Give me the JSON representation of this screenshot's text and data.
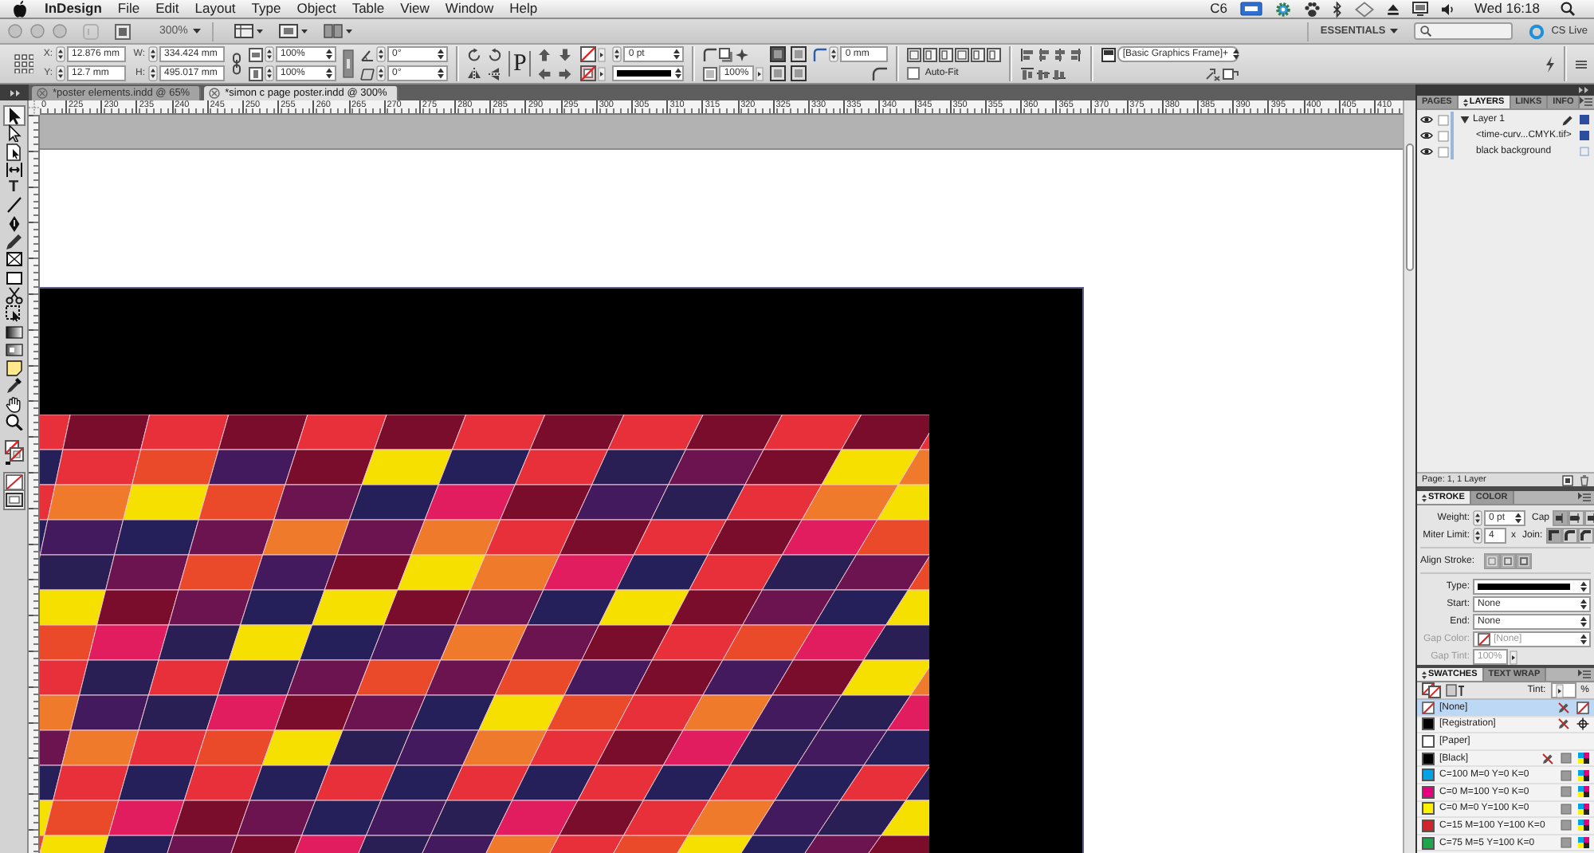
{
  "menu_bar": {
    "app_name": "InDesign",
    "menus": [
      "File",
      "Edit",
      "Layout",
      "Type",
      "Object",
      "Table",
      "View",
      "Window",
      "Help"
    ],
    "status_item": "C6",
    "clock": "Wed 16:18"
  },
  "app_bar": {
    "zoom": "300%",
    "workspace": "ESSENTIALS",
    "cs_live": "CS Live"
  },
  "control_panel": {
    "position_fields": [
      {
        "label": "X:",
        "value": "12.876 mm"
      },
      {
        "label": "Y:",
        "value": "12.7 mm"
      }
    ],
    "size_fields": [
      {
        "label": "W:",
        "value": "334.424 mm"
      },
      {
        "label": "H:",
        "value": "495.017 mm"
      }
    ],
    "scale_fields": [
      "100%",
      "100%"
    ],
    "angle_fields": [
      "0°",
      "0°"
    ],
    "flip_glyph": "P",
    "stroke_weight": "0 pt",
    "opacity": "100%",
    "corner_size": "0 mm",
    "auto_fit": {
      "label": "Auto-Fit",
      "checked": false
    },
    "object_style": "[Basic Graphics Frame]+"
  },
  "tools": [
    {
      "kind": "selection",
      "selected": true
    },
    {
      "kind": "direct-selection",
      "selected": false
    },
    {
      "kind": "page",
      "selected": false
    },
    {
      "kind": "gap",
      "selected": false
    },
    {
      "kind": "type",
      "glyph": "T",
      "selected": false
    },
    {
      "kind": "line",
      "selected": false
    },
    {
      "kind": "pen",
      "selected": false
    },
    {
      "kind": "pencil",
      "selected": false
    },
    {
      "kind": "frame",
      "selected": false
    },
    {
      "kind": "rectangle",
      "selected": false
    },
    {
      "kind": "scissors",
      "selected": false
    },
    {
      "kind": "free-transform",
      "selected": false
    },
    {
      "kind": "gradient",
      "selected": false
    },
    {
      "kind": "gradient-feather",
      "selected": false
    },
    {
      "kind": "note",
      "selected": false
    },
    {
      "kind": "eyedropper",
      "selected": false
    },
    {
      "kind": "hand",
      "selected": false
    },
    {
      "kind": "zoom",
      "selected": false
    },
    {
      "kind": "fill-stroke",
      "selected": false
    },
    {
      "kind": "apply-none",
      "selected": true
    },
    {
      "kind": "screen-mode",
      "selected": true
    }
  ],
  "document_tabs": [
    {
      "label": "*poster elements.indd @ 65%",
      "selected": false
    },
    {
      "label": "*simon c page poster.indd @ 300%",
      "selected": true
    }
  ],
  "ruler_labels": [
    "0",
    "225",
    "230",
    "235",
    "240",
    "245",
    "250",
    "255",
    "260",
    "265",
    "270",
    "275",
    "280",
    "285",
    "290",
    "295",
    "300",
    "305",
    "310",
    "315",
    "320",
    "325",
    "330",
    "335",
    "340",
    "345",
    "350",
    "355",
    "360",
    "365",
    "370",
    "375",
    "380",
    "385",
    "390",
    "395",
    "400",
    "405",
    "410"
  ],
  "layers_panel": {
    "tabs": [
      {
        "label": "PAGES",
        "selected": false
      },
      {
        "label": "LAYERS",
        "selected": true
      },
      {
        "label": "LINKS",
        "selected": false
      },
      {
        "label": "INFO",
        "selected": false
      }
    ],
    "layers": [
      {
        "name": "Layer 1",
        "visible": true,
        "expanded": true,
        "target": true,
        "selected": true,
        "children": [
          {
            "name": "<time-curv...CMYK.tif>",
            "visible": true,
            "selected": true
          },
          {
            "name": "black background",
            "visible": true,
            "selected": false
          }
        ]
      }
    ],
    "footer": "Page: 1, 1 Layer"
  },
  "stroke_panel": {
    "tabs": [
      {
        "label": "STROKE",
        "selected": true
      },
      {
        "label": "COLOR",
        "selected": false
      }
    ],
    "weight": {
      "label": "Weight:",
      "value": "0 pt"
    },
    "cap": {
      "label": "Cap",
      "options": [
        {
          "kind": "butt",
          "selected": true
        },
        {
          "kind": "round",
          "selected": false
        },
        {
          "kind": "square",
          "selected": false
        }
      ]
    },
    "miter_limit": {
      "label": "Miter Limit:",
      "value": "4",
      "unit": "x"
    },
    "join": {
      "label": "Join:",
      "options": [
        {
          "kind": "miter",
          "selected": true
        },
        {
          "kind": "round",
          "selected": false
        },
        {
          "kind": "bevel",
          "selected": false
        }
      ]
    },
    "align_stroke": {
      "label": "Align Stroke:"
    },
    "type": {
      "label": "Type:"
    },
    "start": {
      "label": "Start:",
      "value": "None"
    },
    "end": {
      "label": "End:",
      "value": "None"
    },
    "gap_color": {
      "label": "Gap Color:",
      "value": "[None]",
      "disabled": true
    },
    "gap_tint": {
      "label": "Gap Tint:",
      "value": "100%",
      "disabled": true
    }
  },
  "swatches_panel": {
    "tabs": [
      {
        "label": "SWATCHES",
        "selected": true
      },
      {
        "label": "TEXT WRAP",
        "selected": false
      }
    ],
    "tint": {
      "label": "Tint:",
      "unit": "%"
    },
    "swatches": [
      {
        "name": "[None]",
        "kind": "none",
        "selected": true,
        "editable": false
      },
      {
        "name": "[Registration]",
        "kind": "registration",
        "color": "#000000",
        "selected": false,
        "editable": false
      },
      {
        "name": "[Paper]",
        "kind": "paper",
        "color": "#ffffff",
        "selected": false,
        "editable": true
      },
      {
        "name": "[Black]",
        "kind": "process",
        "color": "#000000",
        "selected": false,
        "editable": false
      },
      {
        "name": "C=100 M=0 Y=0 K=0",
        "kind": "process",
        "color": "#00a4e4",
        "selected": false,
        "editable": true
      },
      {
        "name": "C=0 M=100 Y=0 K=0",
        "kind": "process",
        "color": "#e5007e",
        "selected": false,
        "editable": true
      },
      {
        "name": "C=0 M=0 Y=100 K=0",
        "kind": "process",
        "color": "#fff200",
        "selected": false,
        "editable": true
      },
      {
        "name": "C=15 M=100 Y=100 K=0",
        "kind": "process",
        "color": "#d2232a",
        "selected": false,
        "editable": true
      },
      {
        "name": "C=75 M=5 Y=100 K=0",
        "kind": "process",
        "color": "#1fa64a",
        "selected": false,
        "editable": true
      }
    ]
  }
}
